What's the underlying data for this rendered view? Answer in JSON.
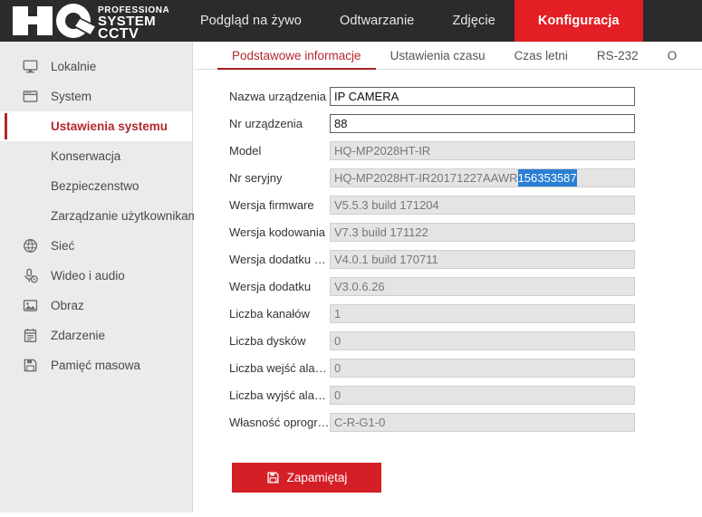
{
  "header": {
    "logo": {
      "mark": "HQ",
      "line1": "PROFESSIONAL",
      "line2": "SYSTEM",
      "line3": "CCTV"
    },
    "accent_color": "#e31e24",
    "bar_color": "#2b2b2b",
    "nav": [
      {
        "label": "Podgląd na żywo",
        "active": false
      },
      {
        "label": "Odtwarzanie",
        "active": false
      },
      {
        "label": "Zdjęcie",
        "active": false
      },
      {
        "label": "Konfiguracja",
        "active": true
      }
    ]
  },
  "sidebar": {
    "items": [
      {
        "label": "Lokalnie",
        "icon": "monitor-icon",
        "sub": false,
        "active": false
      },
      {
        "label": "System",
        "icon": "window-icon",
        "sub": false,
        "active": false
      },
      {
        "label": "Ustawienia systemu",
        "icon": "",
        "sub": true,
        "active": true
      },
      {
        "label": "Konserwacja",
        "icon": "",
        "sub": true,
        "active": false
      },
      {
        "label": "Bezpieczenstwo",
        "icon": "",
        "sub": true,
        "active": false
      },
      {
        "label": "Zarządzanie użytkownikami",
        "icon": "",
        "sub": true,
        "active": false
      },
      {
        "label": "Sieć",
        "icon": "globe-icon",
        "sub": false,
        "active": false
      },
      {
        "label": "Wideo i audio",
        "icon": "microphone-play-icon",
        "sub": false,
        "active": false
      },
      {
        "label": "Obraz",
        "icon": "image-icon",
        "sub": false,
        "active": false
      },
      {
        "label": "Zdarzenie",
        "icon": "calendar-list-icon",
        "sub": false,
        "active": false
      },
      {
        "label": "Pamięć masowa",
        "icon": "floppy-disk-icon",
        "sub": false,
        "active": false
      }
    ]
  },
  "tabs": [
    {
      "label": "Podstawowe informacje",
      "active": true
    },
    {
      "label": "Ustawienia czasu",
      "active": false
    },
    {
      "label": "Czas letni",
      "active": false
    },
    {
      "label": "RS-232",
      "active": false
    },
    {
      "label": "O",
      "active": false
    }
  ],
  "form": {
    "fields": [
      {
        "label": "Nazwa urządzenia",
        "value": "IP CAMERA",
        "readonly": false
      },
      {
        "label": "Nr urządzenia",
        "value": "88",
        "readonly": false
      },
      {
        "label": "Model",
        "value": "HQ-MP2028HT-IR",
        "readonly": true
      },
      {
        "label": "Nr seryjny",
        "value": "HQ-MP2028HT-IR20171227AAWR",
        "selected_value": "156353587",
        "readonly": true
      },
      {
        "label": "Wersja firmware",
        "value": "V5.5.3 build 171204",
        "readonly": true
      },
      {
        "label": "Wersja kodowania",
        "value": "V7.3 build 171122",
        "readonly": true
      },
      {
        "label": "Wersja dodatku WWW",
        "value": "V4.0.1 build 170711",
        "readonly": true
      },
      {
        "label": "Wersja dodatku",
        "value": "V3.0.6.26",
        "readonly": true
      },
      {
        "label": "Liczba kanałów",
        "value": "1",
        "readonly": true
      },
      {
        "label": "Liczba dysków",
        "value": "0",
        "readonly": true
      },
      {
        "label": "Liczba wejść alarmowych",
        "value": "0",
        "readonly": true
      },
      {
        "label": "Liczba wyjść alarmowych",
        "value": "0",
        "readonly": true
      },
      {
        "label": "Własność oprogramowan...",
        "value": "C-R-G1-0",
        "readonly": true
      }
    ],
    "selection_color": "#2a7fd4"
  },
  "actions": {
    "save_label": "Zapamiętaj",
    "save_icon": "floppy-disk-icon",
    "save_color": "#d41f26"
  }
}
